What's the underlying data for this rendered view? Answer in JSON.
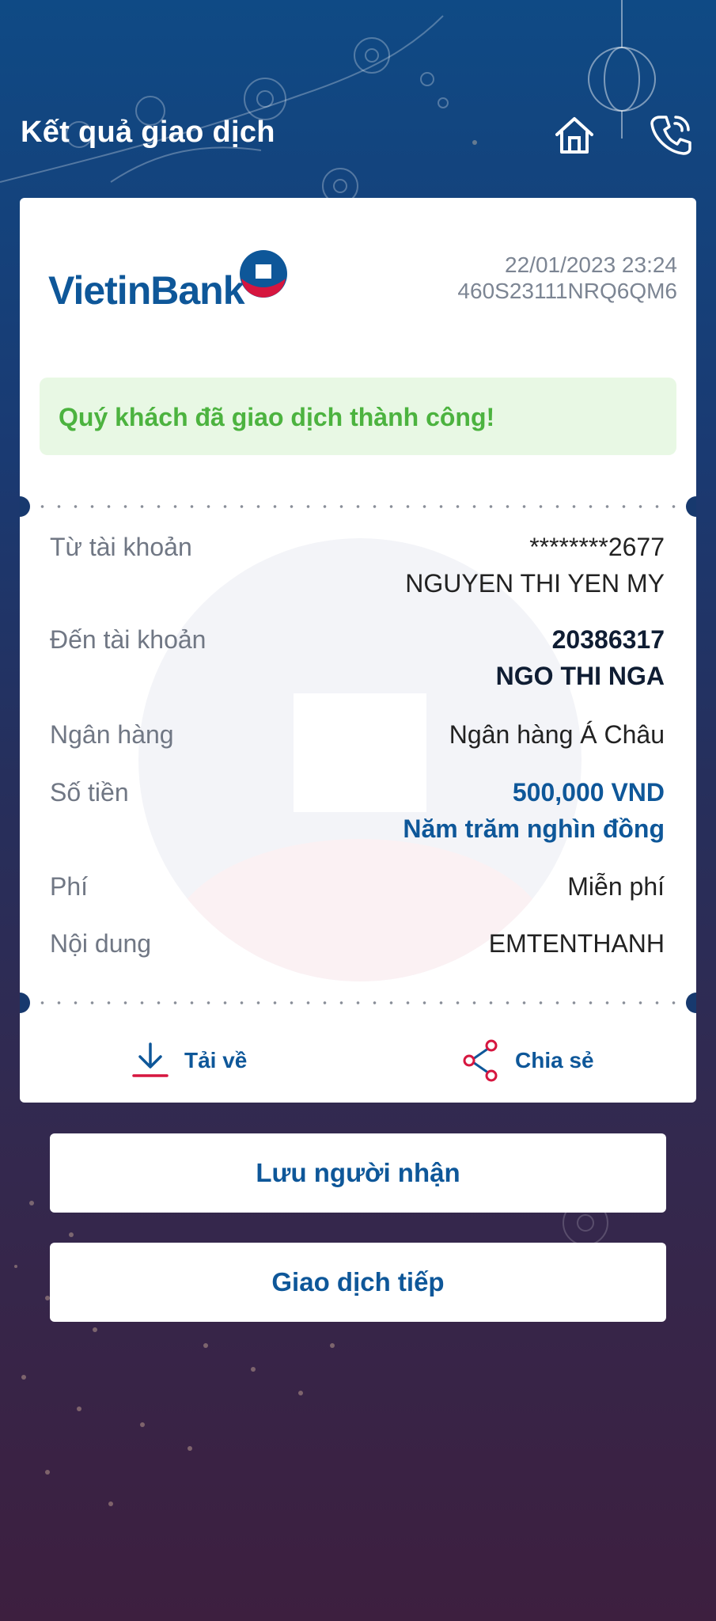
{
  "header": {
    "title": "Kết quả giao dịch",
    "home_icon": "home-icon",
    "phone_icon": "phone-icon"
  },
  "receipt": {
    "bank_logo_text": "VietinBank",
    "datetime": "22/01/2023 23:24",
    "transaction_id": "460S23111NRQ6QM6",
    "success_message": "Quý khách đã giao dịch thành công!",
    "from_label": "Từ tài khoản",
    "from_account": "********2677",
    "from_name": "NGUYEN THI YEN MY",
    "to_label": "Đến tài khoản",
    "to_account": "20386317",
    "to_name": "NGO THI NGA",
    "bank_label": "Ngân hàng",
    "bank_value": "Ngân hàng Á Châu",
    "amount_label": "Số tiền",
    "amount_value": "500,000 VND",
    "amount_words": "Năm trăm nghìn đồng",
    "fee_label": "Phí",
    "fee_value": "Miễn phí",
    "content_label": "Nội dung",
    "content_value": "EMTENTHANH"
  },
  "actions": {
    "download_label": "Tải về",
    "share_label": "Chia sẻ"
  },
  "buttons": {
    "save_recipient": "Lưu người nhận",
    "continue": "Giao dịch tiếp"
  },
  "colors": {
    "brand_blue": "#0e5799",
    "success_green": "#4cb33f",
    "accent_red": "#d6163f"
  }
}
